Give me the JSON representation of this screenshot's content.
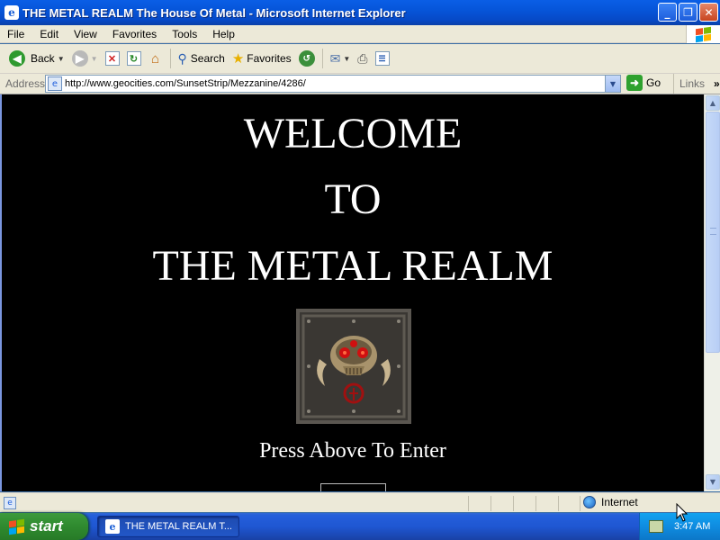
{
  "window": {
    "title": "THE METAL REALM The House Of Metal - Microsoft Internet Explorer",
    "minimize": "_",
    "maximize": "❐",
    "close": "✕"
  },
  "menu": [
    "File",
    "Edit",
    "View",
    "Favorites",
    "Tools",
    "Help"
  ],
  "toolbar": {
    "back_label": "Back",
    "search_label": "Search",
    "favorites_label": "Favorites"
  },
  "address": {
    "label": "Address",
    "url": "http://www.geocities.com/SunsetStrip/Mezzanine/4286/",
    "go_label": "Go",
    "links_label": "Links"
  },
  "page": {
    "line1": "WELCOME",
    "line2": "TO",
    "line3": "THE METAL REALM",
    "enter_text": "Press Above To Enter"
  },
  "status": {
    "zone_label": "Internet"
  },
  "taskbar": {
    "start_label": "start",
    "task_label": "THE METAL REALM T...",
    "clock": "3:47 AM"
  },
  "colors": {
    "page_background": "#000000",
    "page_text": "#ffffff",
    "titlebar_blue": "#0655d9",
    "start_green": "#2f8a2f",
    "skull_red": "#d01010"
  }
}
